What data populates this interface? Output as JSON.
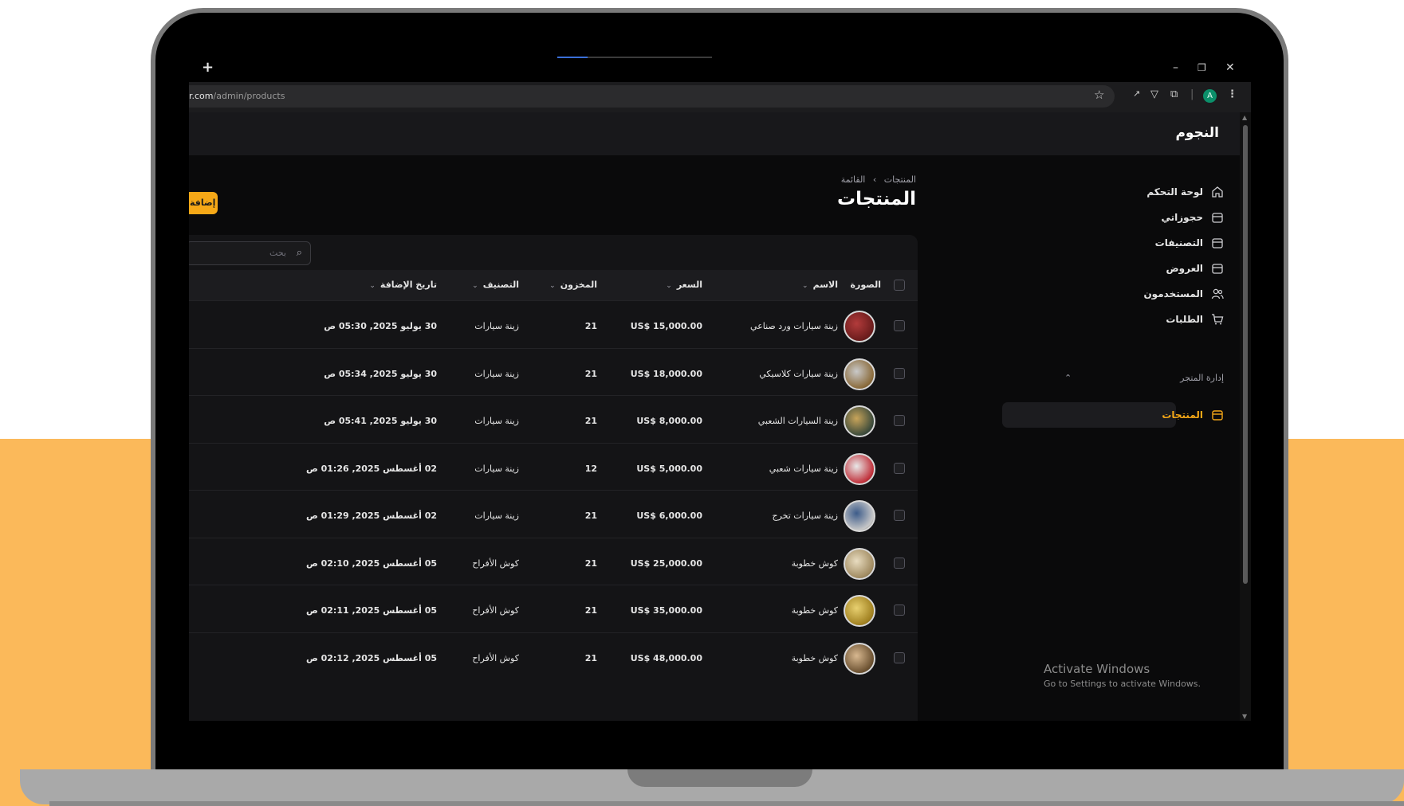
{
  "browser": {
    "new_tab": "+",
    "url_host": "r.com",
    "url_path": "/admin/products",
    "profile_initial": "A",
    "minimize": "–",
    "restore": "❐",
    "close": "✕"
  },
  "app": {
    "brand": "النجوم",
    "sidebar": {
      "items": [
        {
          "label": "لوحة التحكم",
          "icon": "home-icon"
        },
        {
          "label": "حجوزاتي",
          "icon": "box-icon"
        },
        {
          "label": "التصنيفات",
          "icon": "box-icon"
        },
        {
          "label": "العروض",
          "icon": "box-icon"
        },
        {
          "label": "المستخدمون",
          "icon": "users-icon"
        },
        {
          "label": "الطلبات",
          "icon": "cart-icon"
        }
      ],
      "section_label": "إدارة المتجر",
      "active_item": {
        "label": "المنتجات",
        "icon": "box-icon"
      }
    },
    "breadcrumb": {
      "first": "المنتجات",
      "separator": "›",
      "second": "القائمة"
    },
    "page_title": "المنتجات",
    "add_button": "إضافة",
    "search_placeholder": "بحث",
    "table": {
      "headers": {
        "image": "الصورة",
        "name": "الاسم",
        "price": "السعر",
        "stock": "المخزون",
        "category": "التصنيف",
        "date_added": "تاريخ الإضافة"
      },
      "rows": [
        {
          "name": "زينة سيارات ورد صناعي",
          "price": "US$ 15,000.00",
          "stock": "21",
          "category": "زينة سيارات",
          "date": "30 يوليو 2025, 05:30 ص"
        },
        {
          "name": "زينة سيارات كلاسيكي",
          "price": "US$ 18,000.00",
          "stock": "21",
          "category": "زينة سيارات",
          "date": "30 يوليو 2025, 05:34 ص"
        },
        {
          "name": "زينة السيارات الشعبي",
          "price": "US$ 8,000.00",
          "stock": "21",
          "category": "زينة سيارات",
          "date": "30 يوليو 2025, 05:41 ص"
        },
        {
          "name": "زينة سيارات شعبي",
          "price": "US$ 5,000.00",
          "stock": "12",
          "category": "زينة سيارات",
          "date": "02 أغسطس 2025, 01:26 ص"
        },
        {
          "name": "زينة سيارات تخرج",
          "price": "US$ 6,000.00",
          "stock": "21",
          "category": "زينة سيارات",
          "date": "02 أغسطس 2025, 01:29 ص"
        },
        {
          "name": "كوش خطوبة",
          "price": "US$ 25,000.00",
          "stock": "21",
          "category": "كوش الأفراح",
          "date": "05 أغسطس 2025, 02:10 ص"
        },
        {
          "name": "كوش خطوبة",
          "price": "US$ 35,000.00",
          "stock": "21",
          "category": "كوش الأفراح",
          "date": "05 أغسطس 2025, 02:11 ص"
        },
        {
          "name": "كوش خطوبة",
          "price": "US$ 48,000.00",
          "stock": "21",
          "category": "كوش الأفراح",
          "date": "05 أغسطس 2025, 02:12 ص"
        }
      ]
    }
  },
  "windows_watermark": {
    "title": "Activate Windows",
    "subtitle": "Go to Settings to activate Windows."
  },
  "colors": {
    "accent": "#f6a817",
    "background_band": "#fbb95a",
    "screen_bg": "#0a0a0b",
    "avatar": "#0b8f6a"
  }
}
